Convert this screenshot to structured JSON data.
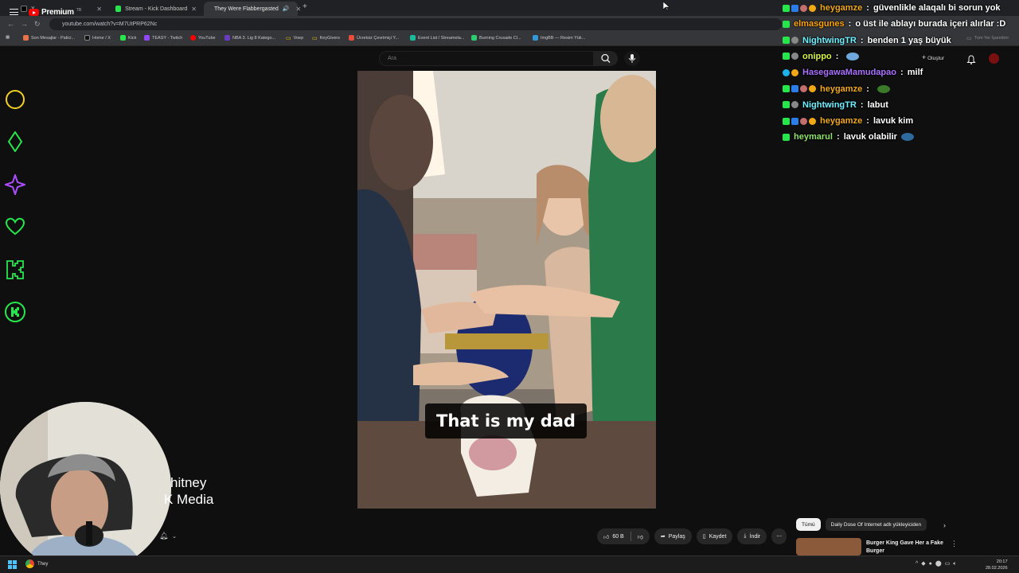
{
  "browser": {
    "tabs": [
      {
        "label": "X",
        "favicon_color": "#111111",
        "active": false
      },
      {
        "label": "Stream - Kick Dashboard",
        "favicon_color": "#27e64c",
        "active": false
      },
      {
        "label": "They Were Flabbergasted",
        "favicon_color": "#ff0000",
        "active": true
      }
    ],
    "new_tab": "+",
    "url": "youtube.com/watch?v=M7UtPRP62Nc",
    "bookmarks": [
      {
        "label": "Son Mesajlar - Patici...",
        "color": "#e8734a"
      },
      {
        "label": "Home / X",
        "color": "#111111"
      },
      {
        "label": "Kick",
        "color": "#27e64c"
      },
      {
        "label": "TEASY - Twitch",
        "color": "#9146ff"
      },
      {
        "label": "YouTube",
        "color": "#ff0000"
      },
      {
        "label": "NBA 3. Lig 8 Katego...",
        "color": "#6a3cc2"
      },
      {
        "label": "Voep",
        "color": "#f1c40f"
      },
      {
        "label": "KeyGivers",
        "color": "#f1c40f"
      },
      {
        "label": "Ücretsiz Çevrimiçi Y...",
        "color": "#e74c3c"
      },
      {
        "label": "Event List / Streamela...",
        "color": "#1abc9c"
      },
      {
        "label": "Burning Crusade Cl...",
        "color": "#2ecc71"
      },
      {
        "label": "ImgBB — Resim Yük...",
        "color": "#3498db"
      }
    ],
    "bookmarks_overflow": "Tüm Yer İşaretleri"
  },
  "youtube": {
    "brand": "Premium",
    "region": "TR",
    "search_placeholder": "Ara",
    "create_label": "Oluştur",
    "caption": "That is my dad",
    "actions": {
      "likes": "60 B",
      "share": "Paylaş",
      "save": "Kaydet",
      "download": "İndir"
    },
    "chips": [
      "Tümü",
      "Daily Dose Of Internet adlı yükleyiciden"
    ],
    "recommendation": {
      "title": "Burger King Gave Her a Fake Burger"
    }
  },
  "stream_overlay": {
    "channel_text_line1": "hitney",
    "channel_text_line2": "K Media",
    "chat": [
      {
        "user": "heygamze",
        "color": "#f0a914",
        "badges": [
          "k",
          "blue",
          "rocket",
          "gold"
        ],
        "text": "güvenlikle alaqalı bi sorun yok",
        "emote": null
      },
      {
        "user": "elmasgunes",
        "color": "#ffa500",
        "badges": [
          "k"
        ],
        "text": "o üst ile ablayı burada içeri alırlar :D",
        "emote": null
      },
      {
        "user": "NightwingTR",
        "color": "#6ef0ff",
        "badges": [
          "k",
          "face"
        ],
        "text": "benden 1 yaş büyük",
        "emote": null
      },
      {
        "user": "onippo",
        "color": "#d6f542",
        "badges": [
          "k",
          "face"
        ],
        "text": "",
        "emote": "#6fa8dc"
      },
      {
        "user": "HasegawaMamudapao",
        "color": "#a970ff",
        "badges": [
          "gem",
          "gold"
        ],
        "text": "milf",
        "emote": null
      },
      {
        "user": "heygamze",
        "color": "#f0a914",
        "badges": [
          "k",
          "blue",
          "rocket",
          "gold"
        ],
        "text": "",
        "emote": "#3a7a2a"
      },
      {
        "user": "NightwingTR",
        "color": "#6ef0ff",
        "badges": [
          "k",
          "face"
        ],
        "text": "labut",
        "emote": null
      },
      {
        "user": "heygamze",
        "color": "#f0a914",
        "badges": [
          "k",
          "blue",
          "rocket",
          "gold"
        ],
        "text": "lavuk kim",
        "emote": null
      },
      {
        "user": "heymarul",
        "color": "#8fe36a",
        "badges": [
          "k"
        ],
        "text": "lavuk olabilir",
        "emote": "#2d6b9e"
      }
    ]
  },
  "taskbar": {
    "app_label": "They",
    "time": "20:17",
    "date": "28.02.2026"
  }
}
